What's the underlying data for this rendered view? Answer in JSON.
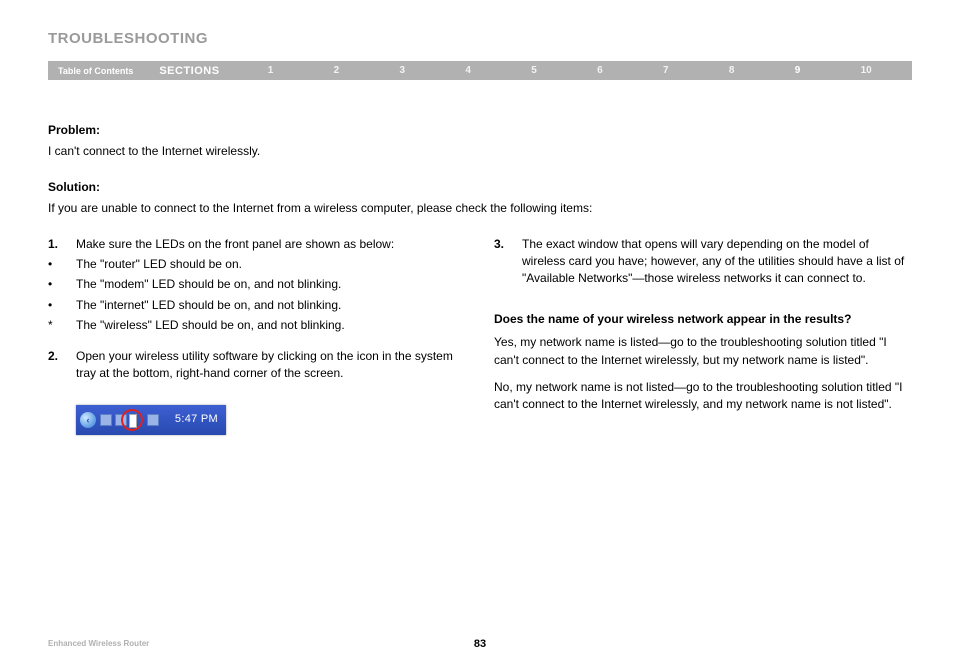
{
  "header": {
    "title": "TROUBLESHOOTING",
    "toc": "Table of Contents",
    "sections_label": "SECTIONS",
    "sections": [
      "1",
      "2",
      "3",
      "4",
      "5",
      "6",
      "7",
      "8",
      "9",
      "10"
    ],
    "active_section": "9"
  },
  "problem": {
    "label": "Problem:",
    "text": "I can't connect to the Internet wirelessly."
  },
  "solution": {
    "label": "Solution:",
    "intro": "If you are unable to connect to the Internet from a wireless computer, please check the following items:"
  },
  "left": {
    "step1": {
      "marker": "1.",
      "text": "Make sure the LEDs on the front panel are shown as below:"
    },
    "bullets": [
      {
        "marker": "•",
        "text": "The \"router\" LED should be on."
      },
      {
        "marker": "•",
        "text": "The \"modem\" LED should be on, and not blinking."
      },
      {
        "marker": "•",
        "text": "The \"internet\" LED should be on, and not blinking."
      },
      {
        "marker": "*",
        "text": "The \"wireless\" LED should be on, and not blinking."
      }
    ],
    "step2": {
      "marker": "2.",
      "text": "Open your wireless utility software by clicking on the icon in the system tray at the bottom, right-hand corner of the screen."
    },
    "tray_time": "5:47 PM"
  },
  "right": {
    "step3": {
      "marker": "3.",
      "text": "The exact window that opens will vary depending on the model of wireless card you have; however, any of the utilities should have a list of \"Available Networks\"—those wireless networks it can connect to."
    },
    "subhead": "Does the name of your wireless network appear in the results?",
    "para1": "Yes, my network name is listed—go to the troubleshooting solution titled \"I can't connect to the Internet wirelessly, but my network name is listed\".",
    "para2": "No, my network name is not listed—go to the troubleshooting solution titled \"I can't connect to the Internet wirelessly, and my network name is not listed\"."
  },
  "footer": {
    "product": "Enhanced Wireless Router",
    "page": "83"
  }
}
